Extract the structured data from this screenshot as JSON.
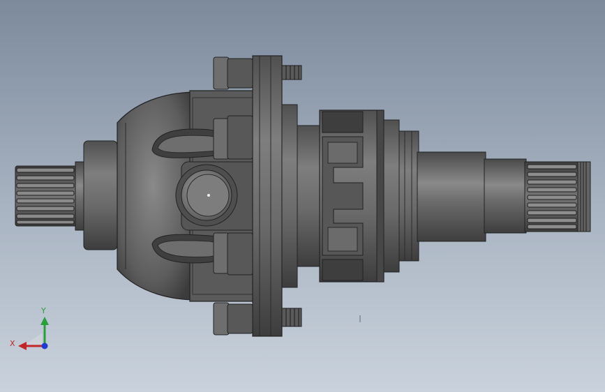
{
  "viewport": {
    "background_top": "#7c8a9c",
    "background_bottom": "#c9d2dc",
    "model_color": "#5f5f5f",
    "edge_color": "#222222"
  },
  "triad": {
    "x_label": "X",
    "y_label": "Y",
    "z_label": "",
    "x_color": "#c0262a",
    "y_color": "#2a9d3c",
    "z_color": "#1f3bd1"
  }
}
